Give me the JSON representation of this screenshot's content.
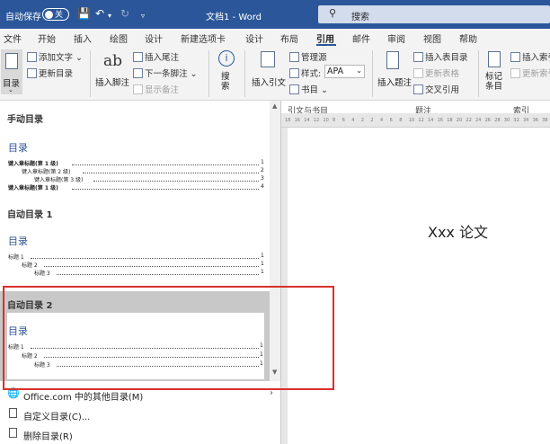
{
  "titlebar": {
    "autosave_label": "自动保存",
    "autosave_state": "关",
    "doc_title": "文档1 - Word",
    "search_placeholder": "搜索"
  },
  "tabs": [
    "文件",
    "开始",
    "插入",
    "绘图",
    "设计",
    "新建选项卡",
    "设计",
    "布局",
    "引用",
    "邮件",
    "审阅",
    "视图",
    "帮助"
  ],
  "active_tab": "引用",
  "ribbon": {
    "toc_button": "目录",
    "add_text": "添加文字",
    "update_toc": "更新目录",
    "insert_footnote_big": "插入脚注",
    "ab_glyph": "ab",
    "insert_endnote": "插入尾注",
    "next_footnote": "下一条脚注",
    "show_notes": "显示备注",
    "search": "搜\n索",
    "insert_citation": "插入引文",
    "manage_sources": "管理源",
    "style_label": "样式:",
    "style_value": "APA",
    "bibliography": "书目",
    "insert_caption": "插入题注",
    "insert_table_of_figures": "插入表目录",
    "update_table": "更新表格",
    "cross_reference": "交叉引用",
    "mark_entry": "标记\n条目",
    "insert_index": "插入索引",
    "update_index": "更新索引",
    "group_citations": "引文与书目",
    "group_captions": "题注",
    "group_index": "索引"
  },
  "gallery": {
    "manual_head": "手动目录",
    "manual_toc_title": "目录",
    "manual_lines": [
      {
        "text": "键入章标题(第 1 级)",
        "page": "1"
      },
      {
        "text": "键入章标题(第 2 级)",
        "page": "2"
      },
      {
        "text": "键入章标题(第 3 级)",
        "page": "3"
      },
      {
        "text": "键入章标题(第 1 级)",
        "page": "4"
      }
    ],
    "auto1_head": "自动目录 1",
    "auto1_toc_title": "目录",
    "auto1_lines": [
      {
        "text": "标题 1",
        "page": "1"
      },
      {
        "text": "标题 2",
        "page": "1"
      },
      {
        "text": "标题 3",
        "page": "1"
      }
    ],
    "auto2_head": "自动目录 2",
    "auto2_toc_title": "目录",
    "auto2_lines": [
      {
        "text": "标题 1",
        "page": "1"
      },
      {
        "text": "标题 2",
        "page": "1"
      },
      {
        "text": "标题 3",
        "page": "1"
      }
    ]
  },
  "bottom_menu": {
    "more_toc": "Office.com 中的其他目录(M)",
    "custom_toc": "自定义目录(C)...",
    "remove_toc": "删除目录(R)"
  },
  "ruler_ticks": [
    "18",
    "16",
    "14",
    "12",
    "10",
    "8",
    "6",
    "4",
    "2",
    "2",
    "4",
    "6",
    "8",
    "10",
    "12",
    "14",
    "16",
    "18",
    "20",
    "22",
    "24",
    "26",
    "28",
    "30",
    "32",
    "34",
    "36",
    "38"
  ],
  "document": {
    "body_text": "Xxx 论文"
  },
  "colors": {
    "titlebar": "#2b579a",
    "highlight": "#d9302c",
    "toc_heading": "#2f5496"
  }
}
